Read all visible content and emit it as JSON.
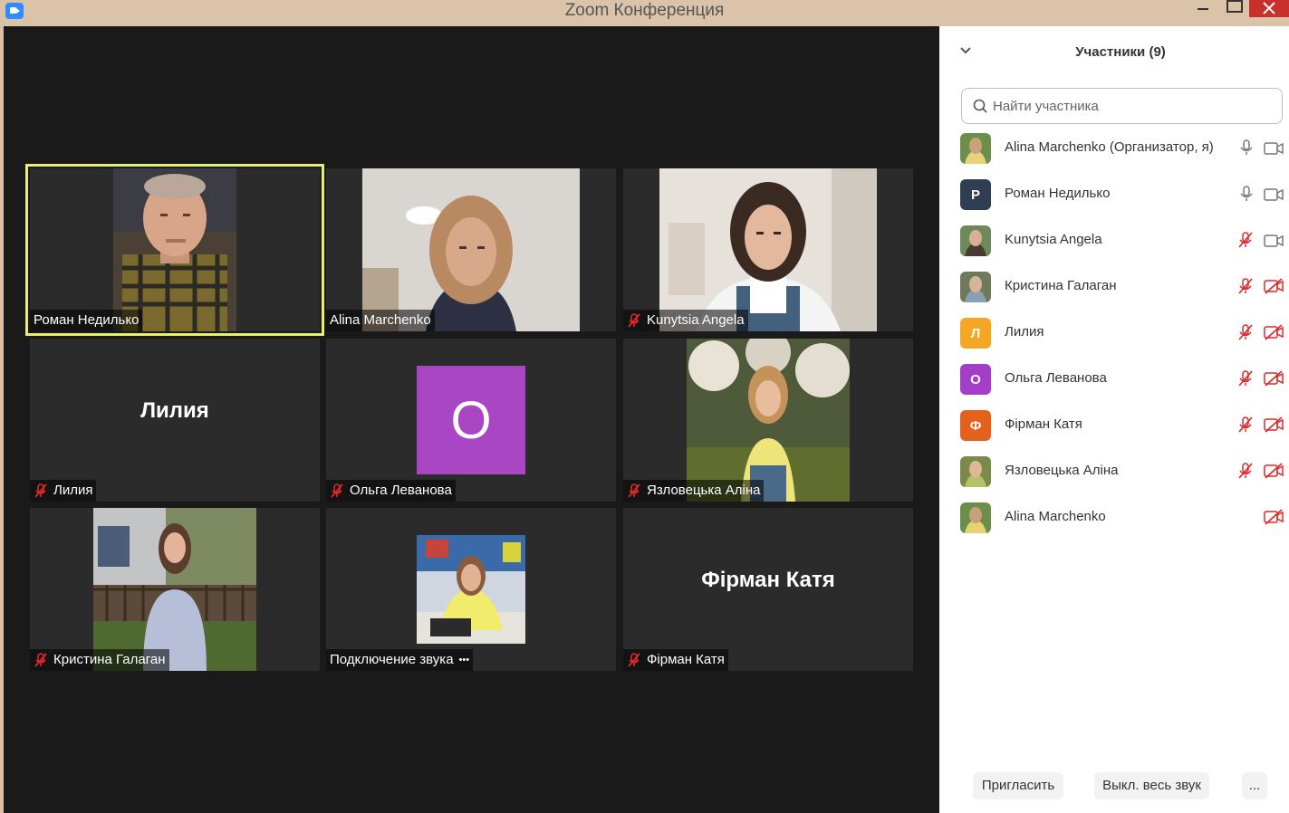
{
  "window": {
    "title": "Zoom Конференция"
  },
  "panel": {
    "title": "Участники (9)",
    "search_placeholder": "Найти участника",
    "participants": [
      {
        "name": "Alina Marchenko (Организатор, я)",
        "avatar_type": "photo",
        "mic": "on",
        "camera": "on"
      },
      {
        "name": "Роман Недилько",
        "avatar_letter": "Р",
        "avatar_color": "#2f3e52",
        "mic": "on",
        "camera": "on"
      },
      {
        "name": "Kunytsia Angela",
        "avatar_type": "photo",
        "mic": "muted",
        "camera": "on"
      },
      {
        "name": "Кристина Галаган",
        "avatar_type": "photo",
        "mic": "muted",
        "camera": "off"
      },
      {
        "name": "Лилия",
        "avatar_letter": "Л",
        "avatar_color": "#f5a623",
        "mic": "muted",
        "camera": "off"
      },
      {
        "name": "Ольга Леванова",
        "avatar_letter": "O",
        "avatar_color": "#a33fc6",
        "mic": "muted",
        "camera": "off"
      },
      {
        "name": "Фірман Катя",
        "avatar_letter": "Ф",
        "avatar_color": "#e5601a",
        "mic": "muted",
        "camera": "off"
      },
      {
        "name": "Язловецька Аліна",
        "avatar_type": "photo",
        "mic": "muted",
        "camera": "off"
      },
      {
        "name": "Alina Marchenko",
        "avatar_type": "photo",
        "mic": "none",
        "camera": "off"
      }
    ],
    "buttons": {
      "invite": "Пригласить",
      "mute_all": "Выкл. весь звук",
      "more": "..."
    }
  },
  "video_tiles": [
    {
      "name": "Роман Недилько",
      "muted": false,
      "active_speaker": true,
      "video": "photo"
    },
    {
      "name": "Alina Marchenko",
      "muted": false,
      "video": "photo"
    },
    {
      "name": "Kunytsia Angela",
      "muted": true,
      "video": "photo"
    },
    {
      "name": "Лилия",
      "muted": true,
      "video": "name",
      "big_name": "Лилия"
    },
    {
      "name": "Ольга Леванова",
      "muted": true,
      "video": "avatar",
      "avatar_letter": "O",
      "avatar_color": "#a846c4"
    },
    {
      "name": "Язловецька Аліна",
      "muted": true,
      "video": "photo"
    },
    {
      "name": "Кристина Галаган",
      "muted": true,
      "video": "photo"
    },
    {
      "name": "Подключение звука",
      "muted": false,
      "video": "photo",
      "connecting_dots": "•••"
    },
    {
      "name": "Фірман Катя",
      "muted": true,
      "video": "name",
      "big_name": "Фірман Катя"
    }
  ],
  "colors": {
    "active_speaker_border": "#e8ef6e",
    "muted_red": "#e02828",
    "video_bg": "#1a1a1a",
    "tile_bg": "#2b2b2b"
  }
}
